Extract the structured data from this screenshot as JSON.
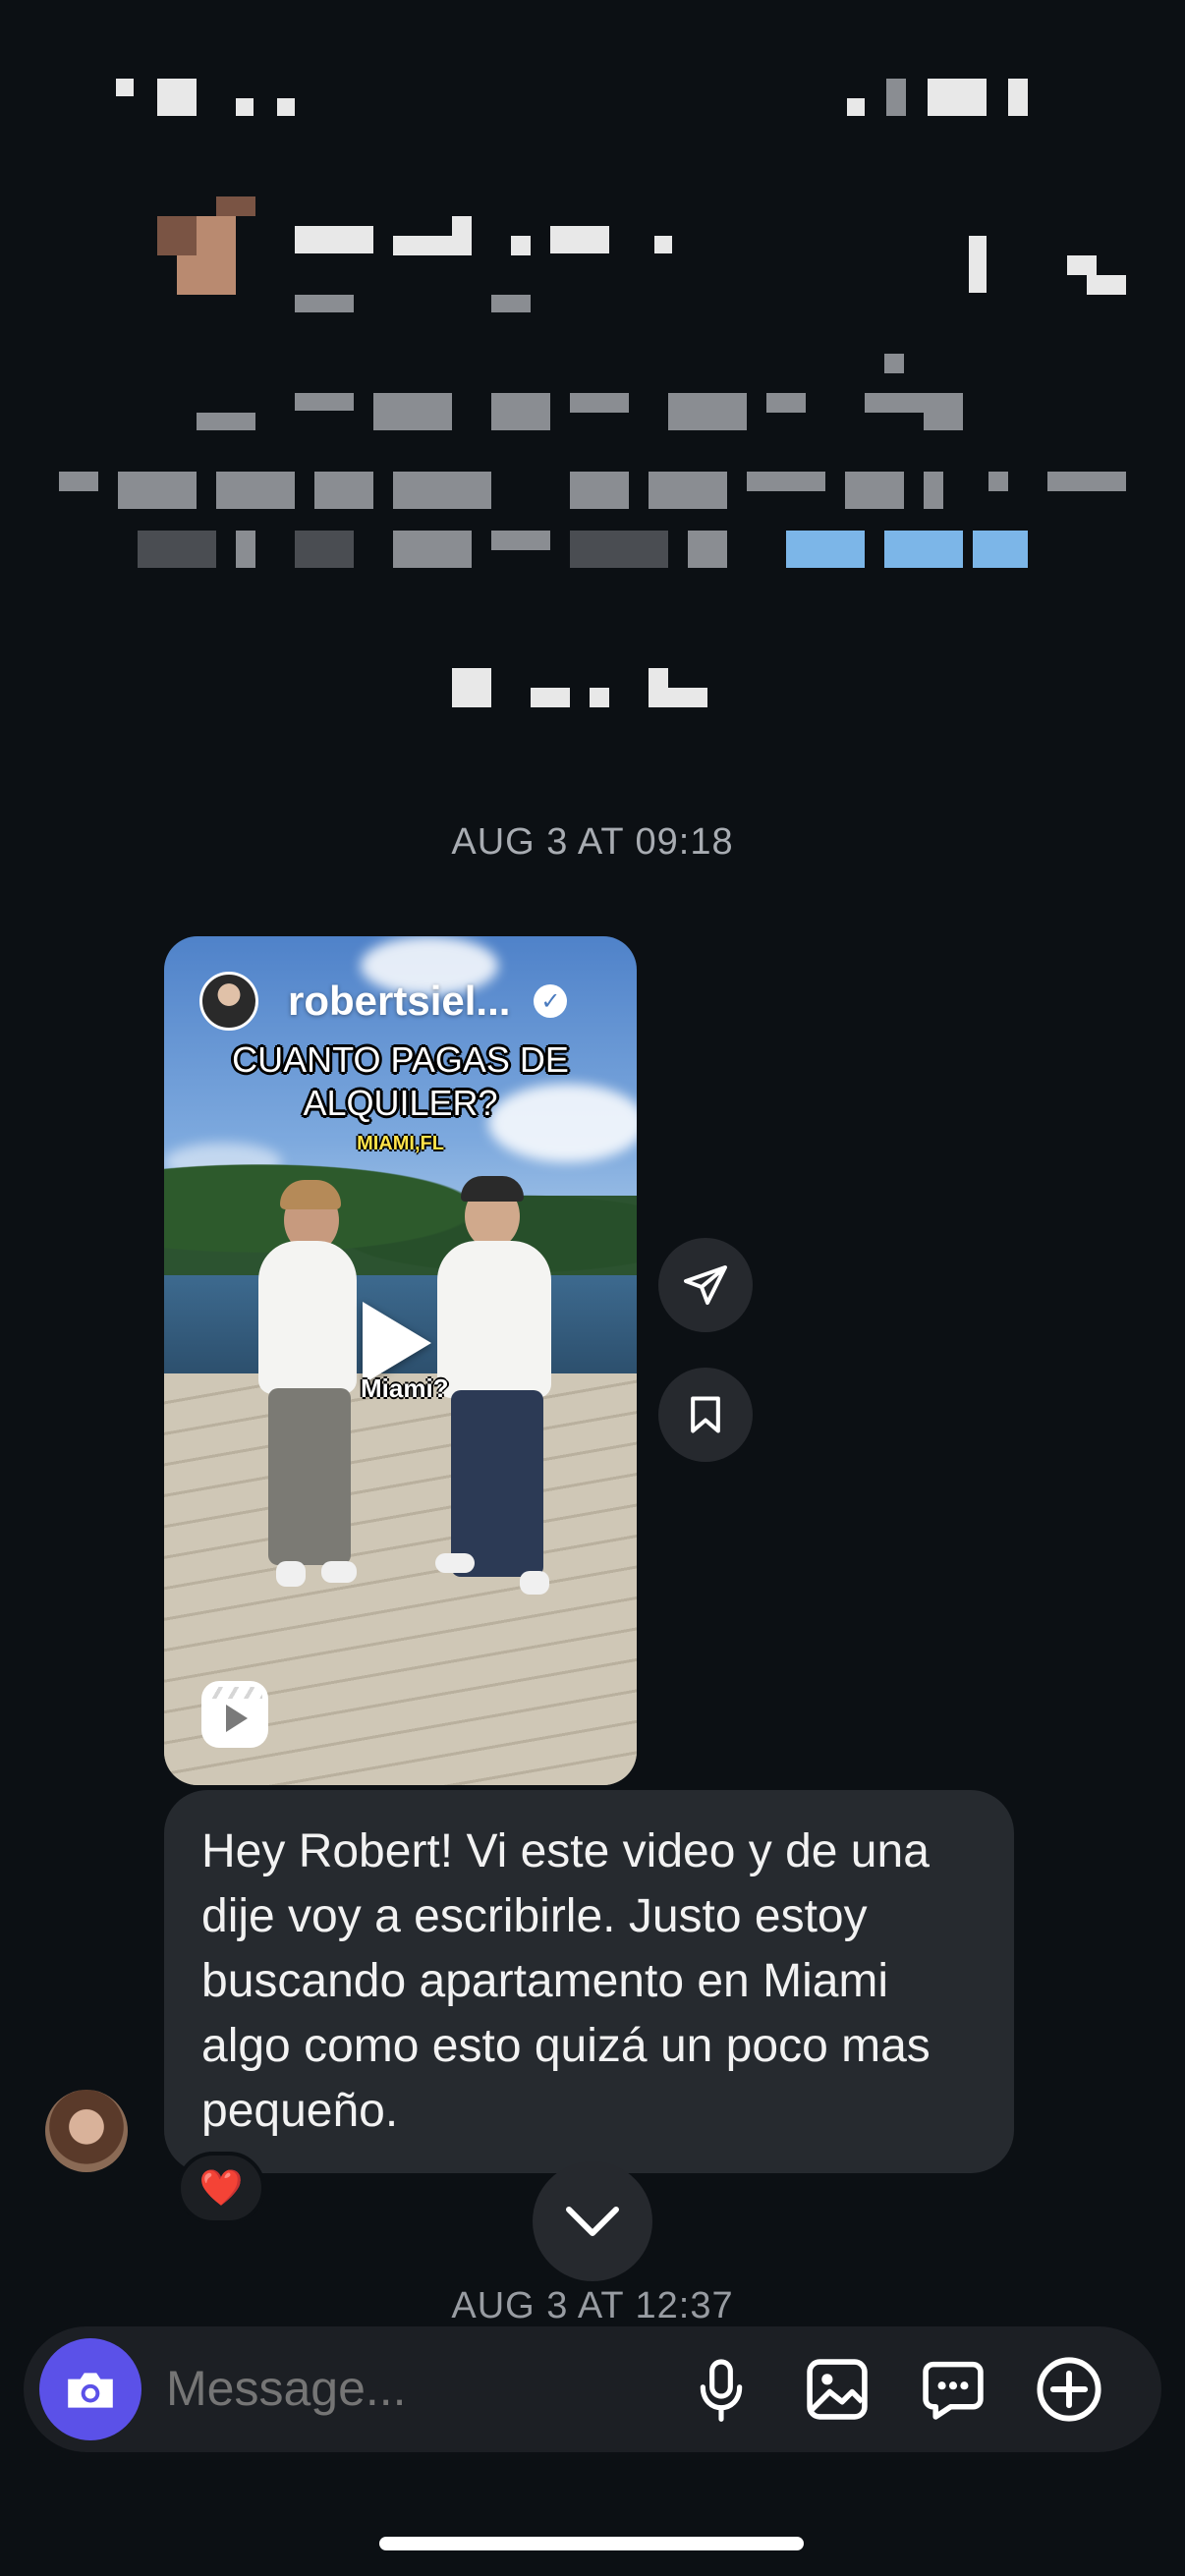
{
  "chat": {
    "timestamp_1": "AUG 3 AT 09:18",
    "timestamp_2": "AUG 3 AT 12:37"
  },
  "shared_reel": {
    "username": "robertsiel...",
    "verified": true,
    "caption": "CUANTO PAGAS DE ALQUILER?",
    "location": "MIAMI,FL",
    "subtitle": "Miami?",
    "icon": "reels-icon"
  },
  "reel_actions": {
    "share_icon": "paper-plane-icon",
    "save_icon": "bookmark-icon"
  },
  "message": {
    "text": "Hey Robert! Vi este video y de una dije voy a escribirle. Justo estoy buscando apartamento en Miami algo como esto quizá un poco mas pequeño.",
    "reaction": "❤️"
  },
  "composer": {
    "placeholder": "Message...",
    "camera_icon": "camera-icon",
    "tools": [
      "microphone-icon",
      "gallery-icon",
      "sticker-chat-icon",
      "plus-icon"
    ]
  },
  "colors": {
    "background": "#0c1014",
    "bubble": "#262a2f",
    "camera_button": "#5b51e8",
    "timestamp": "#a8acb2"
  }
}
